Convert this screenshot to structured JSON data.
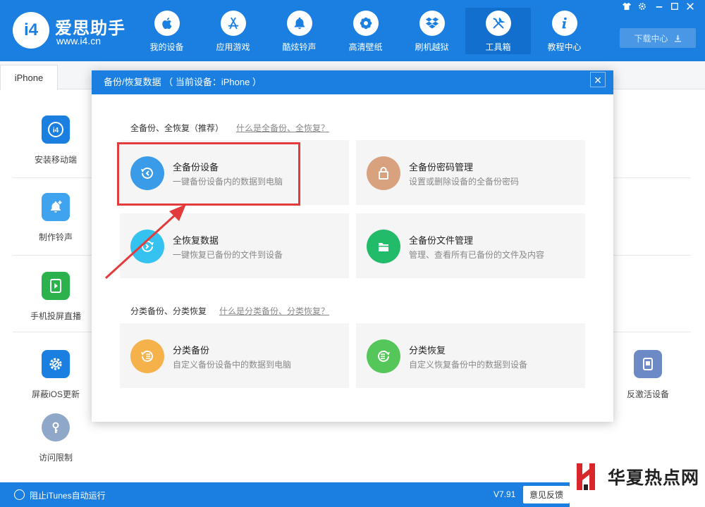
{
  "brand": {
    "name": "爱思助手",
    "url": "www.i4.cn",
    "logo_text": "i4"
  },
  "nav": [
    {
      "label": "我的设备",
      "icon": "apple-icon"
    },
    {
      "label": "应用游戏",
      "icon": "app-store-icon"
    },
    {
      "label": "酷炫铃声",
      "icon": "bell-icon"
    },
    {
      "label": "高清壁纸",
      "icon": "flower-icon"
    },
    {
      "label": "刷机越狱",
      "icon": "dropbox-icon"
    },
    {
      "label": "工具箱",
      "icon": "tools-icon",
      "active": true
    },
    {
      "label": "教程中心",
      "icon": "info-icon"
    }
  ],
  "window_controls": [
    "shirt-icon",
    "gear-icon",
    "minimize-icon",
    "maximize-icon",
    "close-icon"
  ],
  "download": {
    "label": "下载中心"
  },
  "device_tab": {
    "label": "iPhone"
  },
  "tools_left": [
    {
      "label": "安装移动端",
      "icon": "i4-app-icon",
      "color": "#1a7fe0"
    },
    {
      "label": "制作铃声",
      "icon": "bell-plus-icon",
      "color": "#3fa3f0"
    },
    {
      "label": "手机投屏直播",
      "icon": "screen-play-icon",
      "color": "#2bb24c"
    },
    {
      "label": "屏蔽iOS更新",
      "icon": "gear-block-icon",
      "color": "#1a7fe0"
    },
    {
      "label": "访问限制",
      "icon": "key-icon",
      "color": "#8fa7c9"
    }
  ],
  "tools_right": [
    {
      "label": "反激活设备",
      "icon": "device-icon",
      "color": "#6c8bc6"
    }
  ],
  "modal": {
    "title": "备份/恢复数据 （ 当前设备：iPhone ）",
    "close": "×",
    "section1": {
      "title": "全备份、全恢复（推荐）",
      "link": "什么是全备份、全恢复？"
    },
    "section2": {
      "title": "分类备份、分类恢复",
      "link": "什么是分类备份、分类恢复？"
    },
    "cards": [
      {
        "title": "全备份设备",
        "desc": "一键备份设备内的数据到电脑",
        "icon": "backup-icon",
        "color": "#3a9be9"
      },
      {
        "title": "全备份密码管理",
        "desc": "设置或删除设备的全备份密码",
        "icon": "lock-icon",
        "color": "#d9a27f"
      },
      {
        "title": "全恢复数据",
        "desc": "一键恢复已备份的文件到设备",
        "icon": "restore-icon",
        "color": "#35c2f0"
      },
      {
        "title": "全备份文件管理",
        "desc": "管理、查看所有已备份的文件及内容",
        "icon": "folder-icon",
        "color": "#22bb6a"
      },
      {
        "title": "分类备份",
        "desc": "自定义备份设备中的数据到电脑",
        "icon": "category-backup-icon",
        "color": "#f6b24a"
      },
      {
        "title": "分类恢复",
        "desc": "自定义恢复备份中的数据到设备",
        "icon": "category-restore-icon",
        "color": "#55c65a"
      }
    ]
  },
  "status": {
    "itunes_label": "阻止iTunes自动运行",
    "version": "V7.91",
    "feedback": "意见反馈"
  },
  "watermark": {
    "text": "华夏热点网"
  },
  "colors": {
    "primary": "#1a7fe0",
    "highlight": "#e23b3b"
  }
}
